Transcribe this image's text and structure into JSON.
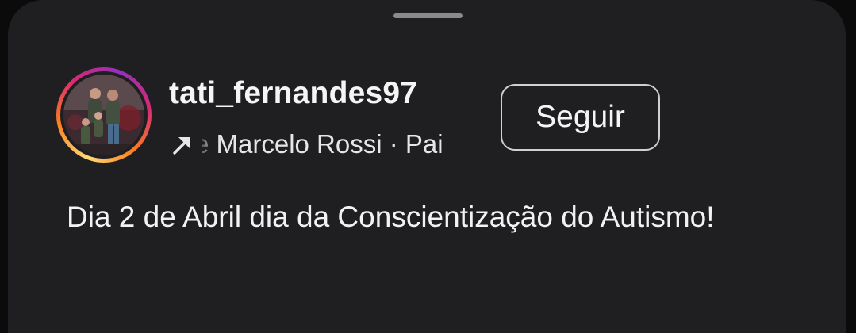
{
  "post": {
    "username": "tati_fernandes97",
    "audio_line": "e Marcelo Rossi · Pai",
    "follow_label": "Seguir",
    "caption": "Dia 2 de Abril dia da Conscientização do Autismo!"
  },
  "icons": {
    "audio_arrow": "arrow-up-right-icon"
  },
  "colors": {
    "background": "#1f1f21",
    "text": "#f5f5f5",
    "ring_gradient": [
      "#feda75",
      "#fa7e1e",
      "#d62976",
      "#962fbf"
    ]
  }
}
